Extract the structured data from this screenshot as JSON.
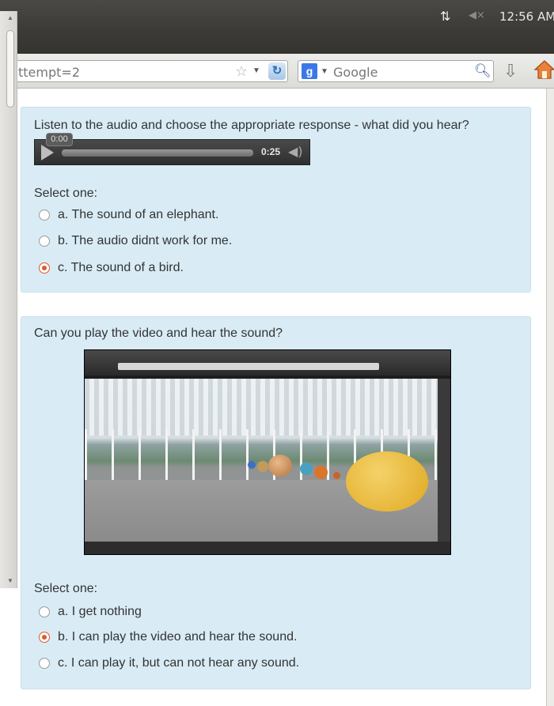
{
  "system_bar": {
    "clock": "12:56 AM"
  },
  "browser": {
    "url_text": "ttempt=2",
    "search_engine": "Google"
  },
  "questions": [
    {
      "text": "Listen to the audio and choose the appropriate response - what did you hear?",
      "audio": {
        "current_time": "0:00",
        "duration": "0:25"
      },
      "select_label": "Select one:",
      "options": [
        {
          "label": "a. The sound of an elephant.",
          "selected": false
        },
        {
          "label": "b. The audio didnt work for me.",
          "selected": false
        },
        {
          "label": "c. The sound of a bird.",
          "selected": true
        }
      ]
    },
    {
      "text": "Can you play the video and hear the sound?",
      "select_label": "Select one:",
      "options": [
        {
          "label": "a. I get nothing",
          "selected": false
        },
        {
          "label": "b. I can play the video and hear the sound.",
          "selected": true
        },
        {
          "label": "c. I can play it, but can not hear any sound.",
          "selected": false
        }
      ]
    }
  ],
  "colors": {
    "question_bg": "#d9ecf5",
    "radio_selected": "#e0592a",
    "topbar": "#3c3b37"
  }
}
